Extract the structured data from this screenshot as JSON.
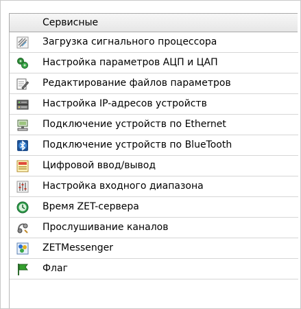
{
  "menu": {
    "header": "Сервисные",
    "items": [
      {
        "label": "Загрузка сигнального процессора",
        "icon": "processor-chip-icon"
      },
      {
        "label": "Настройка параметров АЦП и ЦАП",
        "icon": "adc-dac-settings-icon"
      },
      {
        "label": "Редактирование файлов параметров",
        "icon": "edit-file-icon"
      },
      {
        "label": "Настройка IP-адресов устройств",
        "icon": "network-device-icon"
      },
      {
        "label": "Подключение устройств по Ethernet",
        "icon": "ethernet-icon"
      },
      {
        "label": "Подключение устройств по BlueTooth",
        "icon": "bluetooth-icon"
      },
      {
        "label": "Цифровой ввод/вывод",
        "icon": "digital-io-icon"
      },
      {
        "label": "Настройка входного диапазона",
        "icon": "input-range-icon"
      },
      {
        "label": "Время ZET-сервера",
        "icon": "server-time-icon"
      },
      {
        "label": "Прослушивание каналов",
        "icon": "listen-channels-icon"
      },
      {
        "label": "ZETMessenger",
        "icon": "messenger-icon"
      },
      {
        "label": "Флаг",
        "icon": "flag-icon"
      }
    ]
  }
}
